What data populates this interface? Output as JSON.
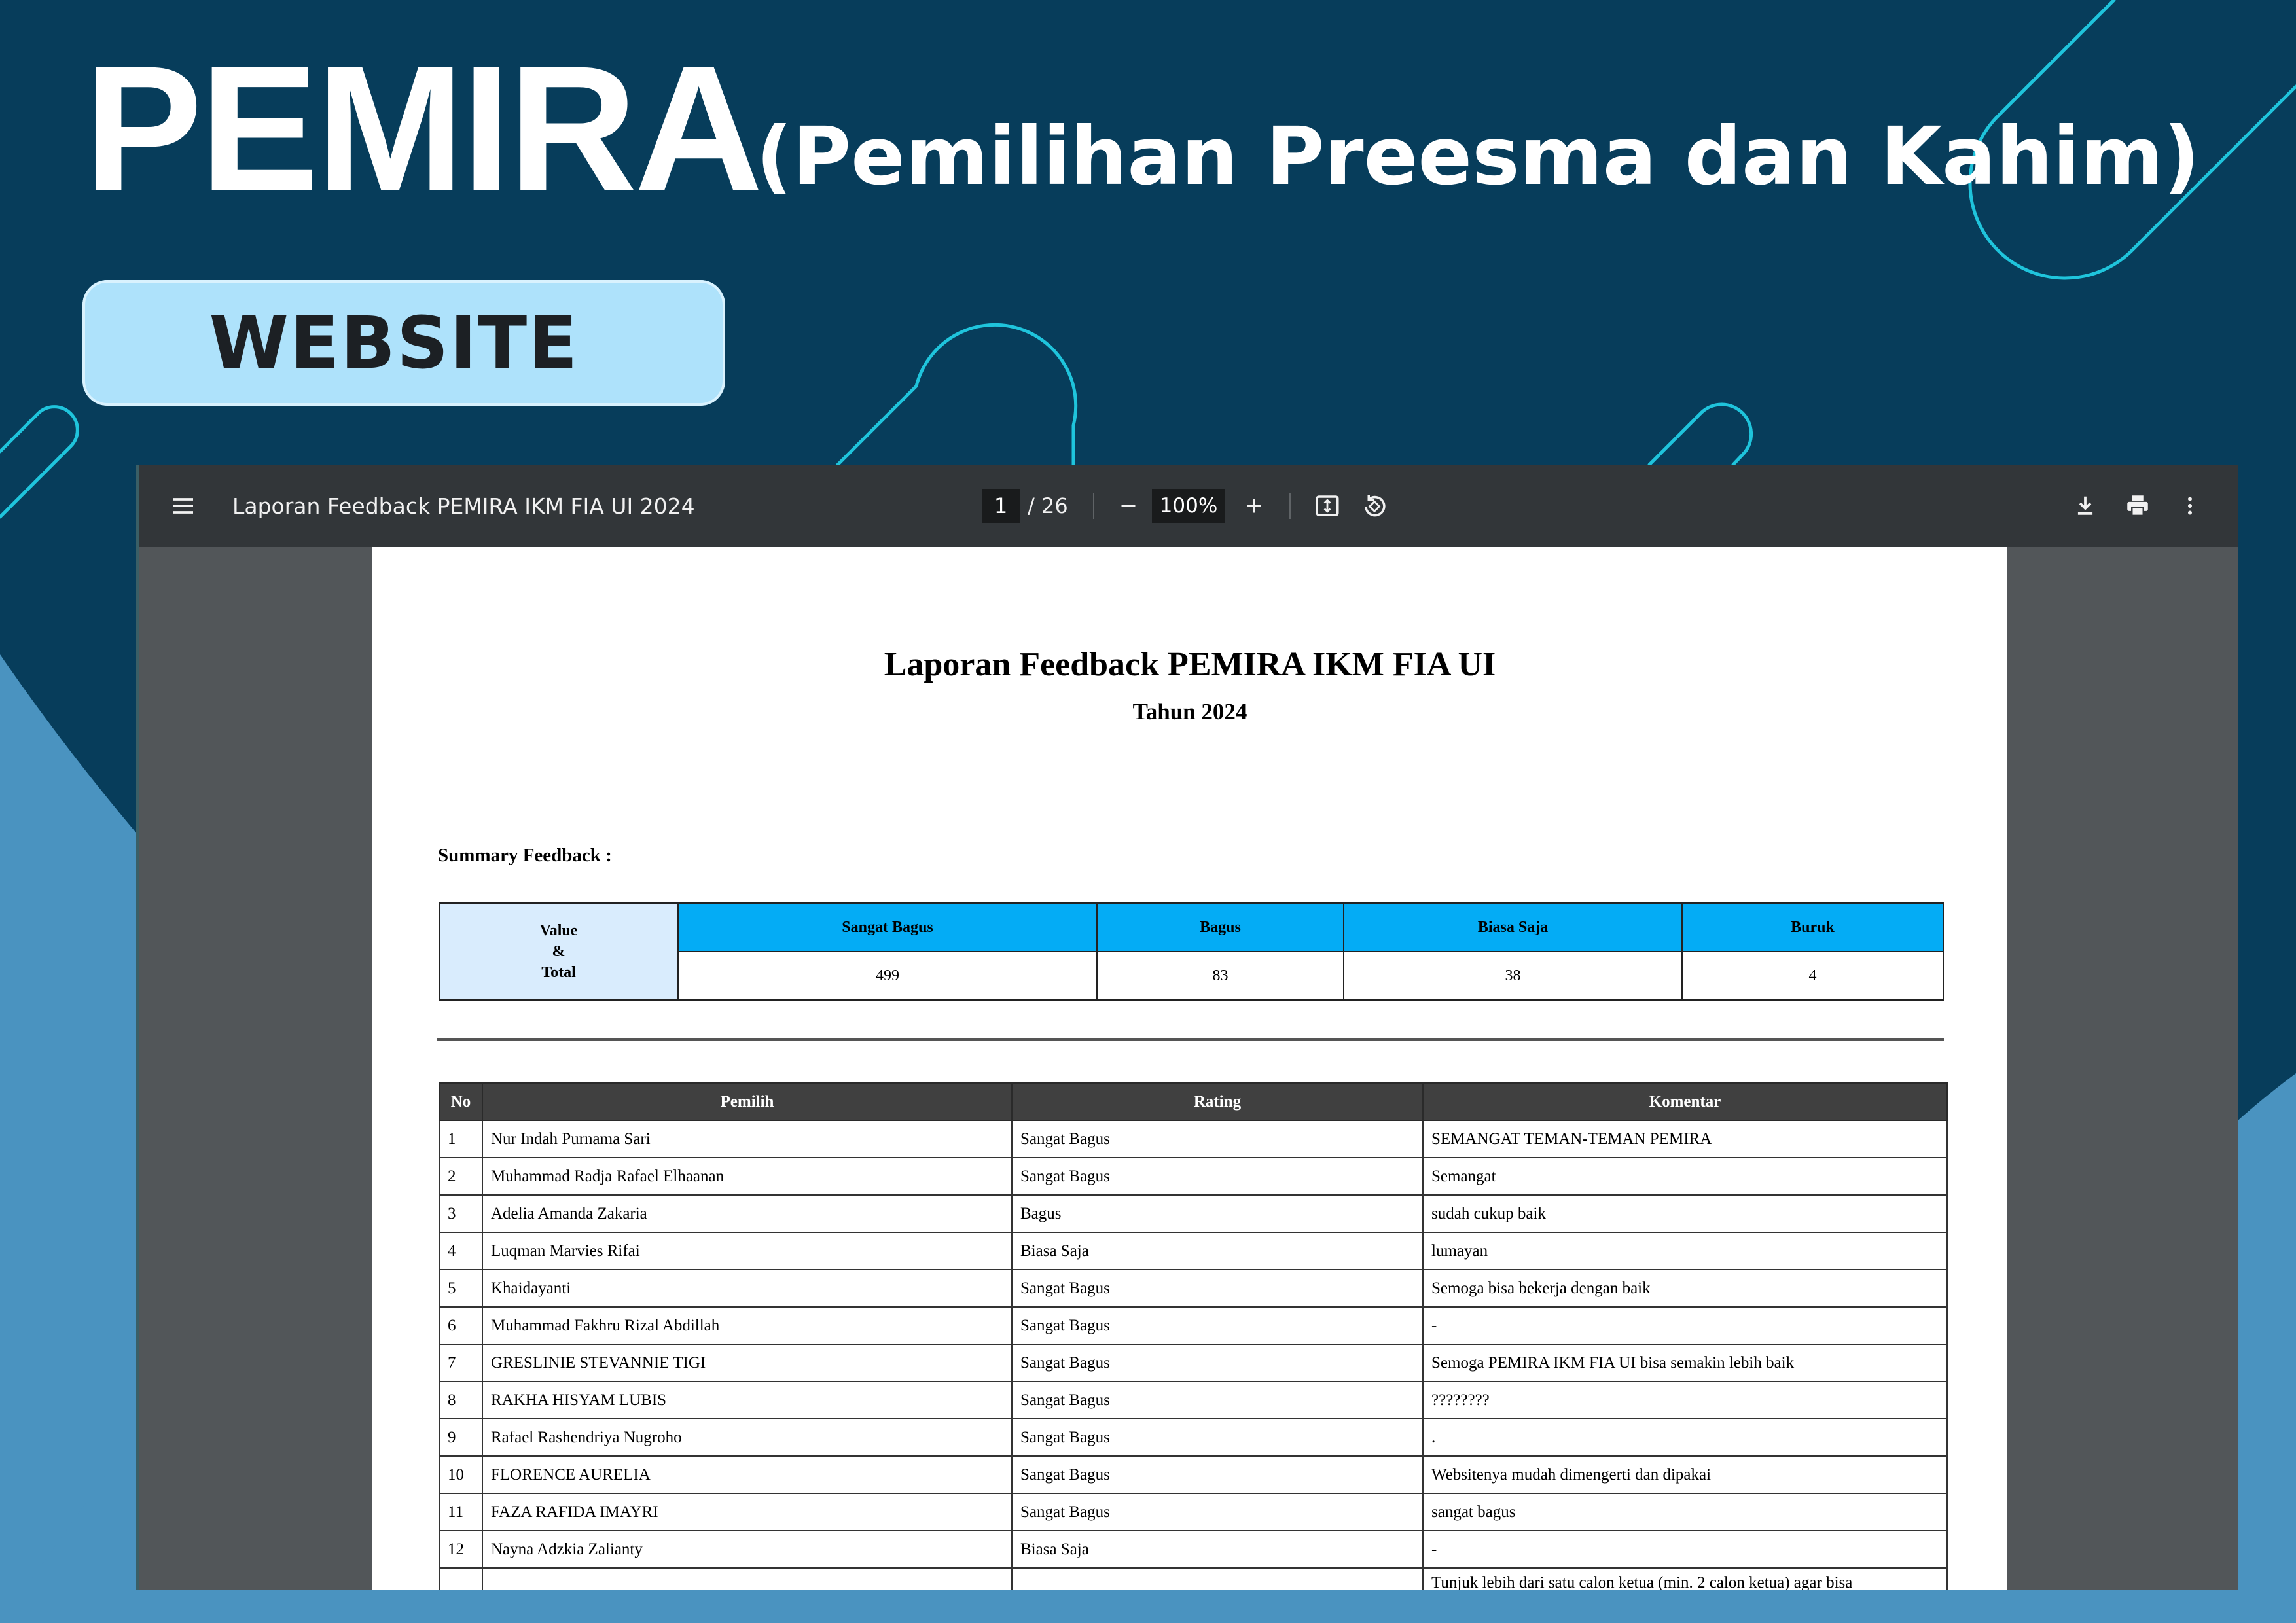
{
  "banner": {
    "title": "PEMIRA",
    "subtitle": "(Pemilihan Preesma dan Kahim)",
    "badge": "WEBSITE"
  },
  "colors": {
    "background_dark": "#073d5b",
    "background_light": "#4a93c0",
    "decor_line": "#1fc4dc",
    "badge": "#aee2fb",
    "table_header_blue": "#04acf5",
    "table_header_dark": "#404040"
  },
  "viewer": {
    "title": "Laporan Feedback PEMIRA IKM FIA UI 2024",
    "page_current": "1",
    "page_total": "/ 26",
    "zoom": "100%",
    "icons": [
      "menu-icon",
      "zoom-out-icon",
      "zoom-in-icon",
      "fit-page-icon",
      "rotate-icon",
      "download-icon",
      "print-icon",
      "more-vert-icon"
    ]
  },
  "document": {
    "title": "Laporan Feedback PEMIRA IKM FIA UI",
    "year": "Tahun 2024",
    "summary_label": "Summary Feedback :",
    "summary": {
      "row_label_1": "Value",
      "row_label_2": "&",
      "row_label_3": "Total",
      "headers": [
        "Sangat Bagus",
        "Bagus",
        "Biasa Saja",
        "Buruk"
      ],
      "values": [
        "499",
        "83",
        "38",
        "4"
      ]
    },
    "table": {
      "headers": [
        "No",
        "Pemilih",
        "Rating",
        "Komentar"
      ],
      "rows": [
        {
          "no": "1",
          "pemilih": "Nur Indah Purnama Sari",
          "rating": "Sangat Bagus",
          "komentar": "SEMANGAT TEMAN-TEMAN PEMIRA"
        },
        {
          "no": "2",
          "pemilih": "Muhammad Radja Rafael Elhaanan",
          "rating": "Sangat Bagus",
          "komentar": "Semangat"
        },
        {
          "no": "3",
          "pemilih": "Adelia Amanda Zakaria",
          "rating": "Bagus",
          "komentar": "sudah cukup baik"
        },
        {
          "no": "4",
          "pemilih": "Luqman Marvies Rifai",
          "rating": "Biasa Saja",
          "komentar": "lumayan"
        },
        {
          "no": "5",
          "pemilih": "Khaidayanti",
          "rating": "Sangat Bagus",
          "komentar": "Semoga bisa bekerja dengan baik"
        },
        {
          "no": "6",
          "pemilih": "Muhammad Fakhru Rizal Abdillah",
          "rating": "Sangat Bagus",
          "komentar": "-"
        },
        {
          "no": "7",
          "pemilih": "GRESLINIE STEVANNIE TIGI",
          "rating": "Sangat Bagus",
          "komentar": "Semoga PEMIRA IKM FIA UI bisa semakin lebih baik"
        },
        {
          "no": "8",
          "pemilih": "RAKHA HISYAM LUBIS",
          "rating": "Sangat Bagus",
          "komentar": "????????"
        },
        {
          "no": "9",
          "pemilih": "Rafael Rashendriya Nugroho",
          "rating": "Sangat Bagus",
          "komentar": "."
        },
        {
          "no": "10",
          "pemilih": "FLORENCE AURELIA",
          "rating": "Sangat Bagus",
          "komentar": "Websitenya mudah dimengerti dan dipakai"
        },
        {
          "no": "11",
          "pemilih": "FAZA RAFIDA IMAYRI",
          "rating": "Sangat Bagus",
          "komentar": "sangat bagus"
        },
        {
          "no": "12",
          "pemilih": "Nayna Adzkia Zalianty",
          "rating": "Biasa Saja",
          "komentar": "-"
        },
        {
          "no": "",
          "pemilih": "",
          "rating": "",
          "komentar": "Tunjuk lebih dari satu calon ketua (min. 2 calon ketua) agar bisa"
        }
      ]
    }
  }
}
